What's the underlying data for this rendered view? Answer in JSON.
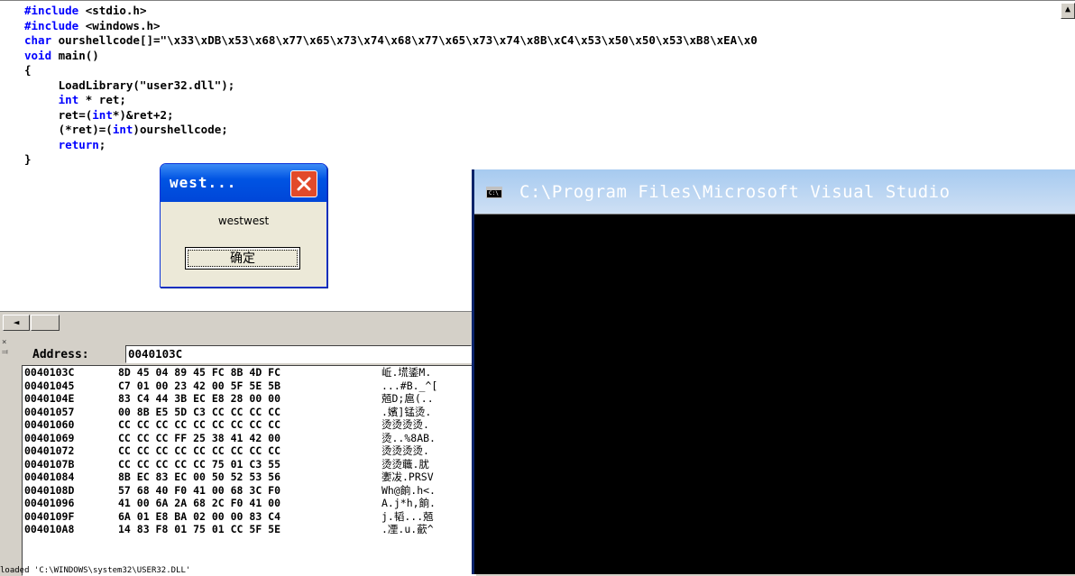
{
  "editor": {
    "code_lines": [
      [
        {
          "t": "#include",
          "kw": true
        },
        {
          "t": " <stdio.h>"
        }
      ],
      [
        {
          "t": "#include",
          "kw": true
        },
        {
          "t": " <windows.h>"
        }
      ],
      [
        {
          "t": "char",
          "kw": true
        },
        {
          "t": " ourshellcode[]=\"\\x33\\xDB\\x53\\x68\\x77\\x65\\x73\\x74\\x68\\x77\\x65\\x73\\x74\\x8B\\xC4\\x53\\x50\\x50\\x53\\xB8\\xEA\\x0"
        }
      ],
      [
        {
          "t": "void",
          "kw": true
        },
        {
          "t": " main()"
        }
      ],
      [
        {
          "t": "{"
        }
      ],
      [
        {
          "t": "     LoadLibrary(\"user32.dll\");"
        }
      ],
      [
        {
          "t": "     "
        },
        {
          "t": "int",
          "kw": true
        },
        {
          "t": " * ret;"
        }
      ],
      [
        {
          "t": "     ret=("
        },
        {
          "t": "int",
          "kw": true
        },
        {
          "t": "*)&ret+2;"
        }
      ],
      [
        {
          "t": "     (*ret)=("
        },
        {
          "t": "int",
          "kw": true
        },
        {
          "t": ")ourshellcode;"
        }
      ],
      [
        {
          "t": "     "
        },
        {
          "t": "return",
          "kw": true
        },
        {
          "t": ";"
        }
      ],
      [
        {
          "t": "}"
        }
      ]
    ]
  },
  "msgbox": {
    "title": "west...",
    "message": "westwest",
    "ok_label": "确定"
  },
  "memory": {
    "address_label": "Address:",
    "address_value": "0040103C",
    "rows": [
      {
        "addr": "0040103C",
        "bytes": "8D 45 04 89 45 FC 8B 4D FC",
        "ascii": "岴.塃鋈M."
      },
      {
        "addr": "00401045",
        "bytes": "C7 01 00 23 42 00 5F 5E 5B",
        "ascii": "...#B._^["
      },
      {
        "addr": "0040104E",
        "bytes": "83 C4 44 3B EC E8 28 00 00",
        "ascii": "兡D;扈(.."
      },
      {
        "addr": "00401057",
        "bytes": "00 8B E5 5D C3 CC CC CC CC",
        "ascii": ".嬪]锰烫."
      },
      {
        "addr": "00401060",
        "bytes": "CC CC CC CC CC CC CC CC CC",
        "ascii": "烫烫烫烫."
      },
      {
        "addr": "00401069",
        "bytes": "CC CC CC FF 25 38 41 42 00",
        "ascii": "烫..%8AB."
      },
      {
        "addr": "00401072",
        "bytes": "CC CC CC CC CC CC CC CC CC",
        "ascii": "烫烫烫烫."
      },
      {
        "addr": "0040107B",
        "bytes": "CC CC CC CC CC 75 01 C3 55",
        "ascii": "烫烫蘵.肬"
      },
      {
        "addr": "00401084",
        "bytes": "8B EC 83 EC 00 50 52 53 56",
        "ascii": "嬱冹.PRSV"
      },
      {
        "addr": "0040108D",
        "bytes": "57 68 40 F0 41 00 68 3C F0",
        "ascii": "Wh@餉.h<."
      },
      {
        "addr": "00401096",
        "bytes": "41 00 6A 2A 68 2C F0 41 00",
        "ascii": "A.j*h,餉."
      },
      {
        "addr": "0040109F",
        "bytes": "6A 01 E8 BA 02 00 00 83 C4",
        "ascii": "j.韬...兡"
      },
      {
        "addr": "004010A8",
        "bytes": "14 83 F8 01 75 01 CC 5F 5E",
        "ascii": ".凐.u.蘝^"
      }
    ],
    "status_text": "loaded 'C:\\WINDOWS\\system32\\USER32.DLL'"
  },
  "console": {
    "title": "C:\\Program Files\\Microsoft Visual Studio"
  },
  "colors": {
    "keyword": "#0000ff",
    "console_bg": "#000000",
    "xp_title_blue": "#0054e3",
    "close_red": "#e24a2a"
  }
}
